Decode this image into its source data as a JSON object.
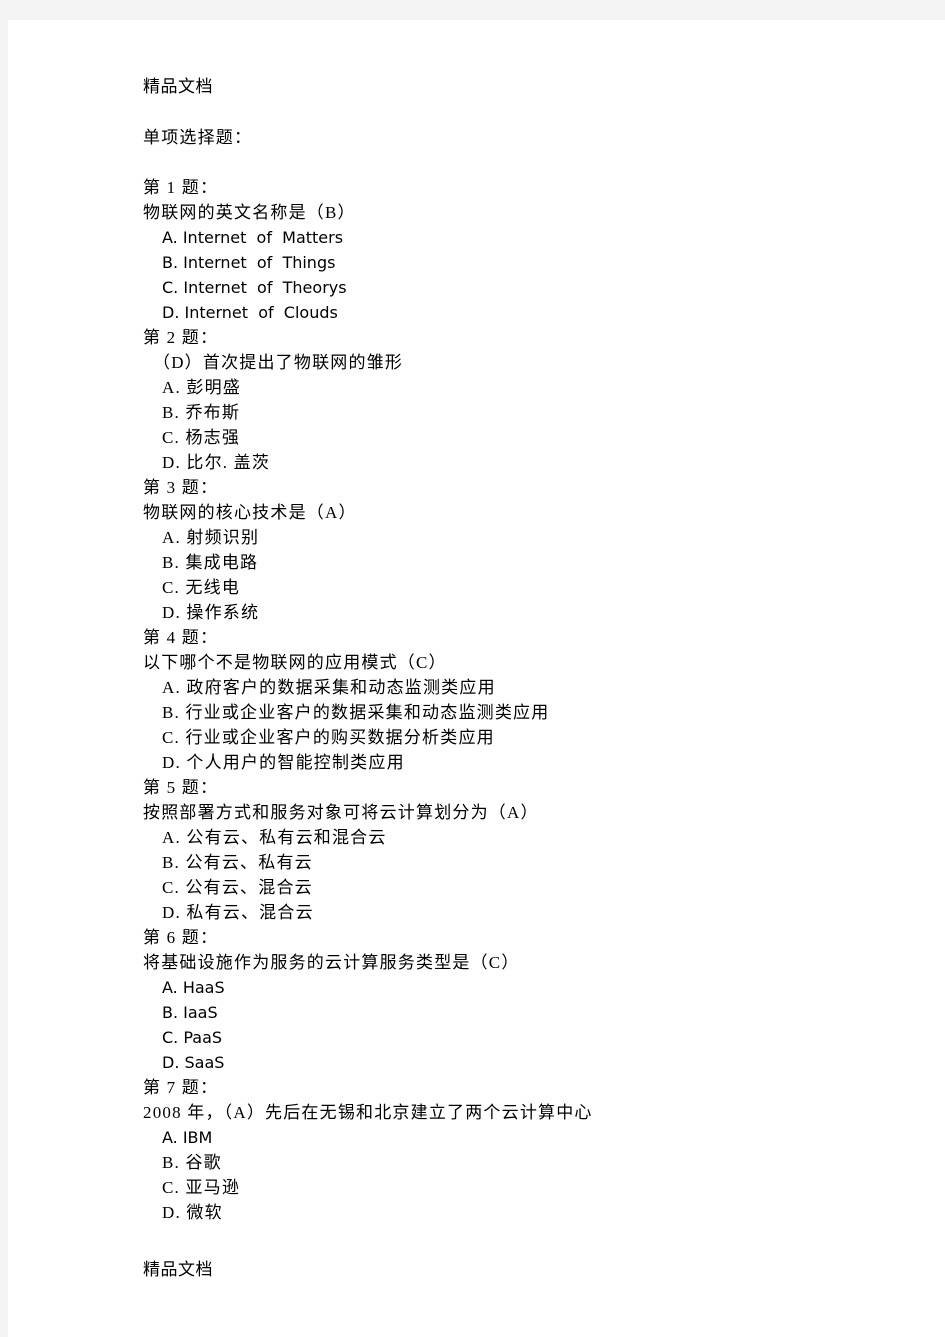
{
  "document": {
    "header_watermark": "精品文档",
    "footer_watermark": "精品文档",
    "section_heading": "单项选择题："
  },
  "questions": [
    {
      "label": "第 1 题：",
      "stem": "物联网的英文名称是（B）",
      "stem_indented": false,
      "option_script": "en",
      "options": [
        "A. Internet  of  Matters",
        "B. Internet  of  Things",
        "C. Internet  of  Theorys",
        "D. Internet  of  Clouds"
      ]
    },
    {
      "label": "第 2 题：",
      "stem": "（D）首次提出了物联网的雏形",
      "stem_indented": true,
      "option_script": "cn",
      "options": [
        "A. 彭明盛",
        "B. 乔布斯",
        "C. 杨志强",
        "D. 比尔. 盖茨"
      ]
    },
    {
      "label": "第 3 题：",
      "stem": "物联网的核心技术是（A）",
      "stem_indented": false,
      "option_script": "cn",
      "options": [
        "A. 射频识别",
        "B. 集成电路",
        "C. 无线电",
        "D. 操作系统"
      ]
    },
    {
      "label": "第 4 题：",
      "stem": "以下哪个不是物联网的应用模式（C）",
      "stem_indented": false,
      "option_script": "cn",
      "options": [
        "A. 政府客户的数据采集和动态监测类应用",
        "B. 行业或企业客户的数据采集和动态监测类应用",
        "C. 行业或企业客户的购买数据分析类应用",
        "D. 个人用户的智能控制类应用"
      ]
    },
    {
      "label": "第 5 题：",
      "stem": "按照部署方式和服务对象可将云计算划分为（A）",
      "stem_indented": false,
      "option_script": "cn",
      "options": [
        "A. 公有云、私有云和混合云",
        "B. 公有云、私有云",
        "C. 公有云、混合云",
        "D. 私有云、混合云"
      ]
    },
    {
      "label": "第 6 题：",
      "stem": "将基础设施作为服务的云计算服务类型是（C）",
      "stem_indented": false,
      "option_script": "en",
      "options": [
        "A. HaaS",
        "B. IaaS",
        "C. PaaS",
        "D. SaaS"
      ]
    },
    {
      "label": "第 7 题：",
      "stem": "2008 年，（A）先后在无锡和北京建立了两个云计算中心",
      "stem_indented": false,
      "option_script": "mixed",
      "options": [
        "A. IBM",
        "B. 谷歌",
        "C. 亚马逊",
        "D. 微软"
      ]
    }
  ]
}
